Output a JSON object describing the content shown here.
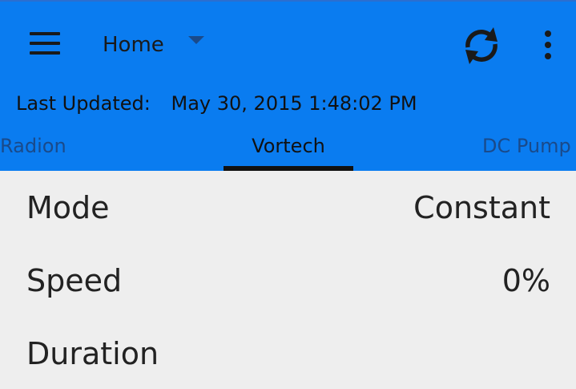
{
  "toolbar": {
    "nav_label": "Home"
  },
  "status": {
    "last_updated_label": "Last Updated:",
    "last_updated_value": "May 30, 2015 1:48:02 PM"
  },
  "tabs": [
    {
      "label": "Radion"
    },
    {
      "label": "Vortech",
      "selected": true
    },
    {
      "label": "DC Pump"
    }
  ],
  "settings": {
    "mode": {
      "key": "Mode",
      "value": "Constant"
    },
    "speed": {
      "key": "Speed",
      "value": "0%"
    },
    "duration": {
      "key": "Duration",
      "value": ""
    }
  },
  "colors": {
    "appbar": "#0a7cf0",
    "background": "#eeeeee",
    "tab_inactive_text": "#1a4a8a",
    "tab_active_text": "#111111"
  },
  "icons": {
    "menu": "hamburger-menu-icon",
    "dropdown": "caret-down-icon",
    "refresh": "refresh-icon",
    "overflow": "overflow-menu-icon"
  }
}
